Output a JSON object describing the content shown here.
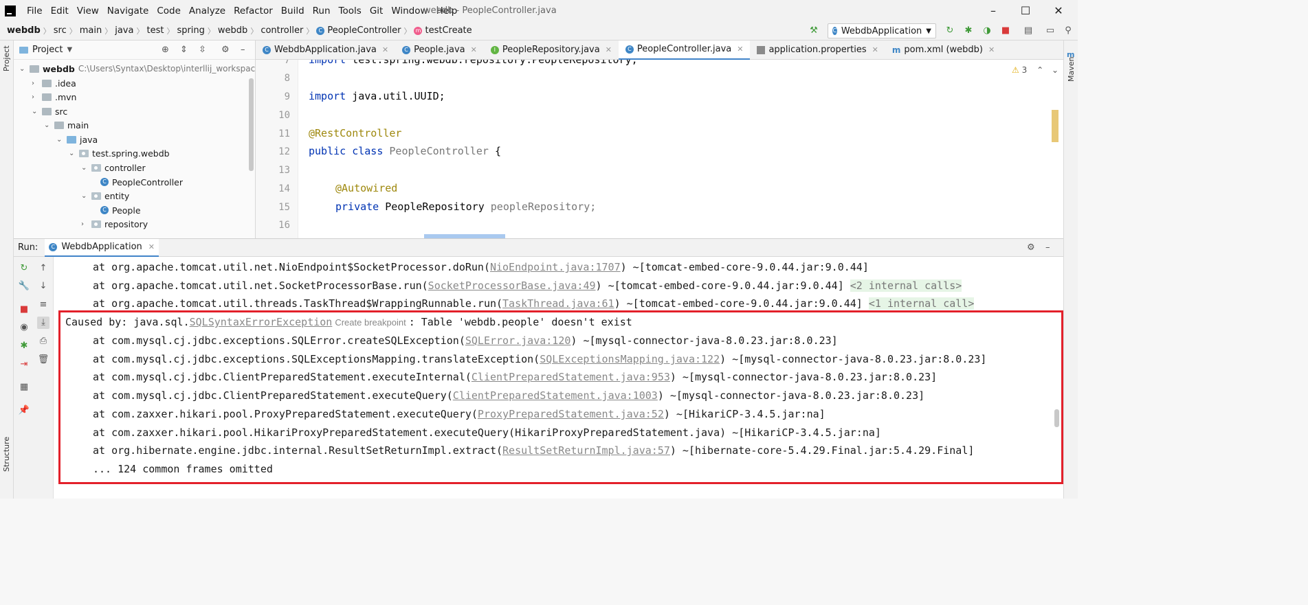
{
  "menubar": {
    "items": [
      "File",
      "Edit",
      "View",
      "Navigate",
      "Code",
      "Analyze",
      "Refactor",
      "Build",
      "Run",
      "Tools",
      "Git",
      "Window",
      "Help"
    ],
    "window_title": "webdb - PeopleController.java"
  },
  "breadcrumb": [
    "webdb",
    "src",
    "main",
    "java",
    "test",
    "spring",
    "webdb",
    "controller",
    "PeopleController",
    "testCreate"
  ],
  "run_config": {
    "label": "WebdbApplication"
  },
  "left_strip": {
    "project_label": "Project",
    "structure_label": "Structure"
  },
  "right_strip": {
    "maven_label": "Maven"
  },
  "project_panel": {
    "title": "Project",
    "root": {
      "name": "webdb",
      "path": "C:\\Users\\Syntax\\Desktop\\interllij_workspace\\web"
    },
    "tree": [
      {
        "label": ".idea",
        "type": "folder",
        "arrow": "›"
      },
      {
        "label": ".mvn",
        "type": "folder",
        "arrow": "›"
      },
      {
        "label": "src",
        "type": "folder",
        "arrow": "⌄"
      },
      {
        "label": "main",
        "type": "folder",
        "arrow": "⌄"
      },
      {
        "label": "java",
        "type": "folder-blue",
        "arrow": "⌄"
      },
      {
        "label": "test.spring.webdb",
        "type": "package",
        "arrow": "⌄"
      },
      {
        "label": "controller",
        "type": "package",
        "arrow": "⌄"
      },
      {
        "label": "PeopleController",
        "type": "class",
        "arrow": ""
      },
      {
        "label": "entity",
        "type": "package",
        "arrow": "⌄"
      },
      {
        "label": "People",
        "type": "class",
        "arrow": ""
      },
      {
        "label": "repository",
        "type": "package",
        "arrow": "›"
      }
    ]
  },
  "editor_tabs": [
    {
      "label": "WebdbApplication.java",
      "icon": "C",
      "active": false
    },
    {
      "label": "People.java",
      "icon": "C",
      "active": false
    },
    {
      "label": "PeopleRepository.java",
      "icon": "I",
      "active": false
    },
    {
      "label": "PeopleController.java",
      "icon": "C",
      "active": true
    },
    {
      "label": "application.properties",
      "icon": "props",
      "active": false
    },
    {
      "label": "pom.xml (webdb)",
      "icon": "m",
      "active": false
    }
  ],
  "editor": {
    "warning_count": "3",
    "lines": [
      {
        "n": "7",
        "text": "import test.spring.webdb.repository.PeopleRepository;"
      },
      {
        "n": "8",
        "text": ""
      },
      {
        "n": "9",
        "text": "import java.util.UUID;"
      },
      {
        "n": "10",
        "text": ""
      },
      {
        "n": "11",
        "text": "@RestController"
      },
      {
        "n": "12",
        "text": "public class PeopleController {"
      },
      {
        "n": "13",
        "text": ""
      },
      {
        "n": "14",
        "text": "    @Autowired"
      },
      {
        "n": "15",
        "text": "    private PeopleRepository peopleRepository;"
      },
      {
        "n": "16",
        "text": ""
      }
    ],
    "import_kw": "import",
    "import_rest": "test.spring.webdb.repository.PeopleRepository;",
    "uuid_rest": "java.util.UUID;",
    "rest_controller": "@RestController",
    "public_kw": "public",
    "class_kw": "class",
    "class_name": "PeopleController",
    "brace": "{",
    "autowired": "@Autowired",
    "private_kw": "private",
    "repo_type": "PeopleRepository",
    "repo_field": "peopleRepository;"
  },
  "run_panel": {
    "label": "Run:",
    "tab": "WebdbApplication"
  },
  "console": {
    "lines": [
      {
        "prefix": "at org.apache.tomcat.util.net.NioEndpoint$SocketProcessor.doRun(",
        "link": "NioEndpoint.java:1707",
        "suffix": ") ~[tomcat-embed-core-9.0.44.jar:9.0.44]",
        "internal": ""
      },
      {
        "prefix": "at org.apache.tomcat.util.net.SocketProcessorBase.run(",
        "link": "SocketProcessorBase.java:49",
        "suffix": ") ~[tomcat-embed-core-9.0.44.jar:9.0.44] ",
        "internal": "<2 internal calls>"
      },
      {
        "prefix": "at org.apache.tomcat.util.threads.TaskThread$WrappingRunnable.run(",
        "link": "TaskThread.java:61",
        "suffix": ") ~[tomcat-embed-core-9.0.44.jar:9.0.44] ",
        "internal": "<1 internal call>"
      }
    ],
    "caused_by_prefix": "Caused by: java.sql.",
    "caused_by_link": "SQLSyntaxErrorException",
    "create_breakpoint": "Create breakpoint",
    "caused_by_suffix": ": Table 'webdb.people' doesn't exist",
    "trace": [
      {
        "prefix": "at com.mysql.cj.jdbc.exceptions.SQLError.createSQLException(",
        "link": "SQLError.java:120",
        "suffix": ") ~[mysql-connector-java-8.0.23.jar:8.0.23]"
      },
      {
        "prefix": "at com.mysql.cj.jdbc.exceptions.SQLExceptionsMapping.translateException(",
        "link": "SQLExceptionsMapping.java:122",
        "suffix": ") ~[mysql-connector-java-8.0.23.jar:8.0.23]"
      },
      {
        "prefix": "at com.mysql.cj.jdbc.ClientPreparedStatement.executeInternal(",
        "link": "ClientPreparedStatement.java:953",
        "suffix": ") ~[mysql-connector-java-8.0.23.jar:8.0.23]"
      },
      {
        "prefix": "at com.mysql.cj.jdbc.ClientPreparedStatement.executeQuery(",
        "link": "ClientPreparedStatement.java:1003",
        "suffix": ") ~[mysql-connector-java-8.0.23.jar:8.0.23]"
      },
      {
        "prefix": "at com.zaxxer.hikari.pool.ProxyPreparedStatement.executeQuery(",
        "link": "ProxyPreparedStatement.java:52",
        "suffix": ") ~[HikariCP-3.4.5.jar:na]"
      },
      {
        "prefix": "at com.zaxxer.hikari.pool.HikariProxyPreparedStatement.executeQuery(HikariProxyPreparedStatement.java) ~[HikariCP-3.4.5.jar:na]",
        "link": "",
        "suffix": ""
      },
      {
        "prefix": "at org.hibernate.engine.jdbc.internal.ResultSetReturnImpl.extract(",
        "link": "ResultSetReturnImpl.java:57",
        "suffix": ") ~[hibernate-core-5.4.29.Final.jar:5.4.29.Final]"
      }
    ],
    "omitted": "... 124 common frames omitted"
  },
  "colors": {
    "highlight": "#e3202a",
    "accent": "#4083c9"
  }
}
